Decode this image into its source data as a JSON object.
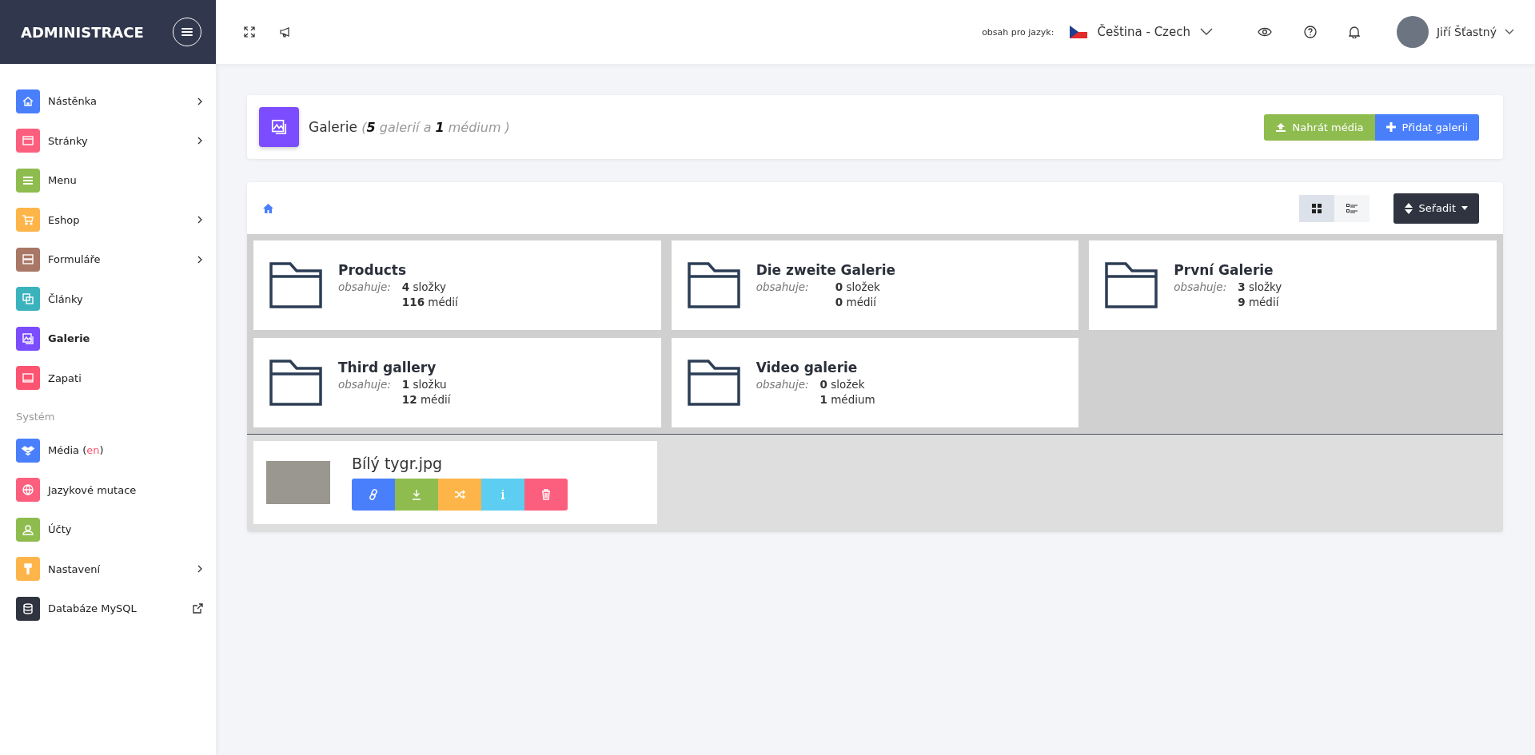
{
  "sidebar": {
    "brand": "ADMINISTRACE",
    "items": [
      {
        "label": "Nástěnka",
        "color": "#4a7ffc",
        "selected": false,
        "kind": "submenu"
      },
      {
        "label": "Stránky",
        "color": "#fc5f7e",
        "selected": false,
        "kind": "submenu"
      },
      {
        "label": "Menu",
        "color": "#8fbc4f",
        "selected": false,
        "kind": "plain"
      },
      {
        "label": "Eshop",
        "color": "#fdb54a",
        "selected": false,
        "kind": "submenu"
      },
      {
        "label": "Formuláře",
        "color": "#a87766",
        "selected": false,
        "kind": "submenu"
      },
      {
        "label": "Články",
        "color": "#3bb3bd",
        "selected": false,
        "kind": "plain"
      },
      {
        "label": "Galerie",
        "color": "#7b4dff",
        "selected": true,
        "kind": "plain"
      },
      {
        "label": "Zapati",
        "color": "#fc5471",
        "selected": false,
        "kind": "plain"
      }
    ],
    "section": "Systém",
    "system_items": [
      {
        "label": "Média (",
        "note": "en",
        "note_end": ")",
        "color": "#4a7ffc",
        "selected": false,
        "kind": "plain"
      },
      {
        "label": "Jazykové mutace",
        "color": "#fc5f7e",
        "selected": false,
        "kind": "plain"
      },
      {
        "label": "Účty",
        "color": "#8fbc4f",
        "selected": false,
        "kind": "plain"
      },
      {
        "label": "Nastavení",
        "color": "#fdb54a",
        "selected": false,
        "kind": "submenu"
      },
      {
        "label": "Databáze MySQL",
        "color": "#2f3440",
        "selected": false,
        "kind": "external"
      }
    ]
  },
  "topbar": {
    "language_label": "obsah pro jazyk:",
    "language": "Čeština - Czech",
    "user": "Jiří Šťastný"
  },
  "header": {
    "title": "Galerie",
    "summary": "(**5** galerií a **1** médium )",
    "buttons": [
      {
        "label": "Nahrát média",
        "kind": "upload"
      },
      {
        "label": "Přidat galerii",
        "kind": "add"
      }
    ]
  },
  "toolbar": {
    "views": [
      {
        "kind": "grid",
        "selected": true
      },
      {
        "kind": "list",
        "selected": false
      }
    ],
    "sort": "Seřadit"
  },
  "folders": [
    {
      "name": "Products",
      "contains": "obsahuje:",
      "folders": "**4** složky",
      "media": "**116** médií"
    },
    {
      "name": "Die zweite Galerie",
      "contains": "obsahuje:",
      "folders": "**0** složek",
      "media": "**0** médií"
    },
    {
      "name": "První Galerie",
      "contains": "obsahuje:",
      "folders": "**3** složky",
      "media": "**9** médií"
    },
    {
      "name": "Third gallery",
      "contains": "obsahuje:",
      "folders": "**1** složku",
      "media": "**12** médií"
    },
    {
      "name": "Video galerie",
      "contains": "obsahuje:",
      "folders": "**0** složek",
      "media": "**1** médium"
    }
  ],
  "media": [
    {
      "name": "Bílý tygr.jpg"
    }
  ]
}
